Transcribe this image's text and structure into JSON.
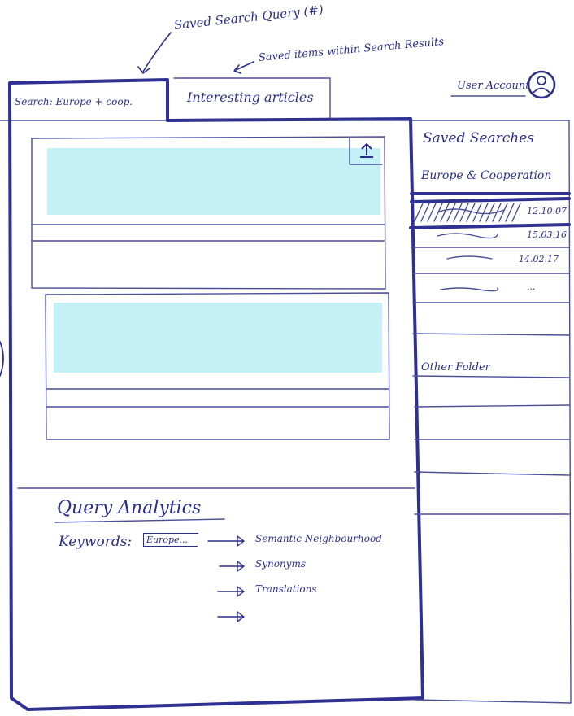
{
  "annotations": {
    "saved_search_query": "Saved Search Query (#)",
    "saved_items": "Saved items within Search Results"
  },
  "tabs": [
    {
      "label": "Search: Europe + coop."
    },
    {
      "label": "Interesting articles"
    }
  ],
  "user_account": {
    "label": "User Account"
  },
  "sidebar": {
    "title": "Saved Searches",
    "selected_search": "Europe & Cooperation",
    "entries": [
      {
        "date": "12.10.07"
      },
      {
        "date": "15.03.16"
      },
      {
        "date": "14.02.17"
      },
      {
        "date": "..."
      }
    ],
    "other_folder": "Other Folder"
  },
  "analytics": {
    "title": "Query Analytics",
    "keywords_label": "Keywords:",
    "keyword_chip": "Europe...",
    "links": [
      "Semantic Neighbourhood",
      "Synonyms",
      "Translations",
      ""
    ]
  },
  "colors": {
    "ink": "#2b2f8a",
    "highlight": "#b9eef5"
  },
  "icons": {
    "export": "upload-icon",
    "user": "user-avatar-icon"
  }
}
